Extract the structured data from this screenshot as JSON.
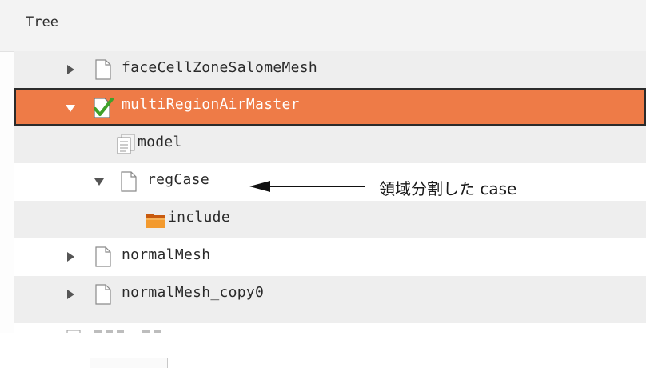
{
  "panel": {
    "title": "Tree"
  },
  "tree": {
    "items": [
      {
        "label": "faceCellZoneSalomeMesh",
        "icon": "file-icon",
        "expander": "collapsed"
      },
      {
        "label": "multiRegionAirMaster",
        "icon": "checked-case-icon",
        "expander": "expanded",
        "selected": true
      },
      {
        "label": "model",
        "icon": "document-icon",
        "expander": "none"
      },
      {
        "label": "regCase",
        "icon": "file-icon",
        "expander": "expanded"
      },
      {
        "label": "include",
        "icon": "folder-icon",
        "expander": "none"
      },
      {
        "label": "normalMesh",
        "icon": "file-icon",
        "expander": "collapsed"
      },
      {
        "label": "normalMesh_copy0",
        "icon": "file-icon",
        "expander": "collapsed"
      }
    ]
  },
  "annotation": {
    "text": "領域分割した case"
  },
  "colors": {
    "selected": "#ee7b47",
    "stripe": "#eeeeee"
  }
}
